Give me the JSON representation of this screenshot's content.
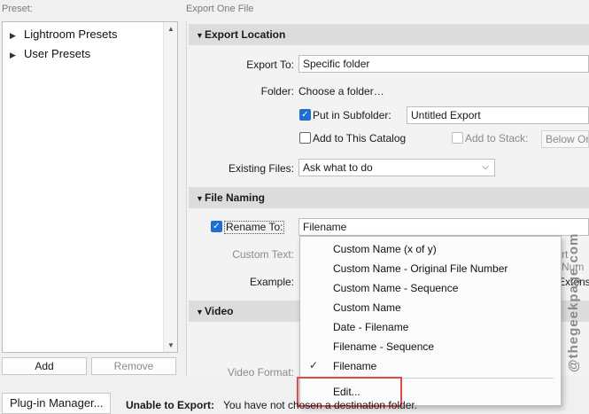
{
  "left_panel": {
    "label": "Preset:",
    "tree": [
      {
        "label": "Lightroom Presets"
      },
      {
        "label": "User Presets"
      }
    ],
    "add_label": "Add",
    "remove_label": "Remove"
  },
  "right_panel": {
    "title": "Export One File",
    "export_location": {
      "header": "Export Location",
      "export_to_label": "Export To:",
      "export_to_value": "Specific folder",
      "folder_label": "Folder:",
      "folder_value": "Choose a folder…",
      "subfolder_label": "Put in Subfolder:",
      "subfolder_value": "Untitled Export",
      "add_catalog_label": "Add to This Catalog",
      "add_stack_label": "Add to Stack:",
      "stack_value": "Below Orig",
      "existing_files_label": "Existing Files:",
      "existing_files_value": "Ask what to do"
    },
    "file_naming": {
      "header": "File Naming",
      "rename_label": "Rename To:",
      "rename_value": "Filename",
      "custom_text_label": "Custom Text:",
      "example_label": "Example:",
      "extension_partial": "Extensi",
      "partial_right": "rt Num"
    },
    "video": {
      "header": "Video",
      "video_format_label": "Video Format:"
    }
  },
  "menu": {
    "items": [
      {
        "label": "Custom Name (x of y)"
      },
      {
        "label": "Custom Name - Original File Number"
      },
      {
        "label": "Custom Name - Sequence"
      },
      {
        "label": "Custom Name"
      },
      {
        "label": "Date - Filename"
      },
      {
        "label": "Filename - Sequence"
      },
      {
        "label": "Filename"
      }
    ],
    "selected": "Filename",
    "edit_label": "Edit..."
  },
  "bottom": {
    "plugin_manager_label": "Plug-in Manager...",
    "warning_label": "Unable to Export:",
    "warning_text": "You have not chosen a destination folder."
  },
  "watermark": "@thegeekpage.com",
  "colors": {
    "accent": "#1f6fd1",
    "highlight": "#e24a4a"
  }
}
